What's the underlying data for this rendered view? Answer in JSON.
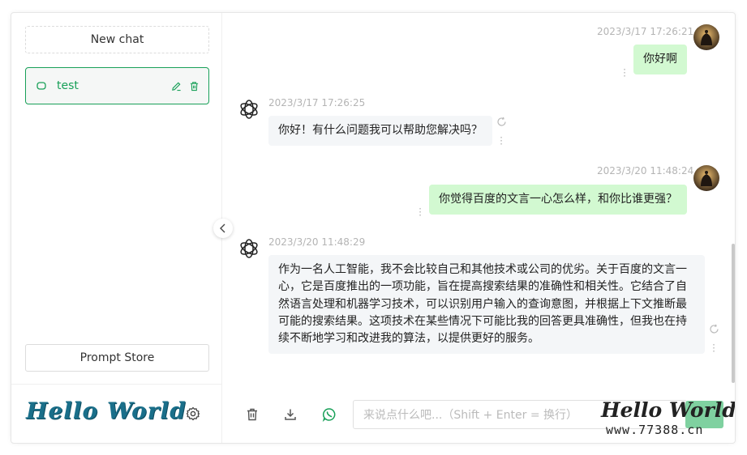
{
  "sidebar": {
    "new_chat_label": "New chat",
    "conversations": [
      {
        "title": "test"
      }
    ],
    "prompt_store_label": "Prompt Store",
    "logo_text": "Hello World"
  },
  "messages": [
    {
      "role": "user",
      "time": "2023/3/17 17:26:21",
      "text": "你好啊"
    },
    {
      "role": "assistant",
      "time": "2023/3/17 17:26:25",
      "text": "你好！有什么问题我可以帮助您解决吗？"
    },
    {
      "role": "user",
      "time": "2023/3/20 11:48:24",
      "text": "你觉得百度的文言一心怎么样，和你比谁更强？"
    },
    {
      "role": "assistant",
      "time": "2023/3/20 11:48:29",
      "text": "作为一名人工智能，我不会比较自己和其他技术或公司的优劣。关于百度的文言一心，它是百度推出的一项功能，旨在提高搜索结果的准确性和相关性。它结合了自然语言处理和机器学习技术，可以识别用户输入的查询意图，并根据上下文推断最可能的搜索结果。这项技术在某些情况下可能比我的回答更具准确性，但我也在持续不断地学习和改进我的算法，以提供更好的服务。"
    }
  ],
  "input": {
    "placeholder": "来说点什么吧...（Shift + Enter = 换行）"
  },
  "watermark": {
    "line1": "Hello World",
    "line2": "www.77388.cn"
  },
  "colors": {
    "accent": "#18a058",
    "user_bubble": "#d2f9d1",
    "bot_bubble": "#f4f6f8",
    "send": "#7fd1a0"
  }
}
